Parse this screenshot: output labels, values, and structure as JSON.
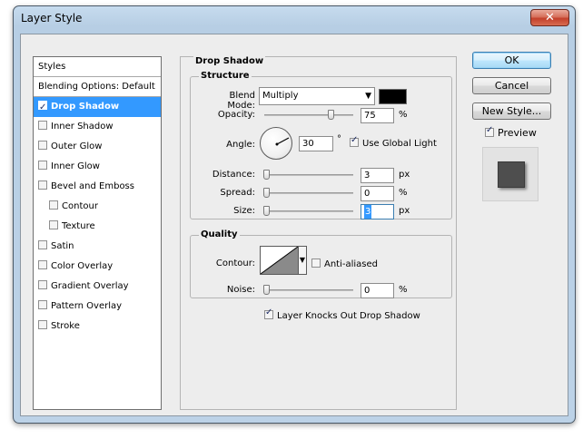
{
  "window": {
    "title": "Layer Style",
    "close_glyph": "✕"
  },
  "styles": {
    "header": "Styles",
    "blending": "Blending Options: Default",
    "items": [
      {
        "label": "Drop Shadow",
        "checked": true,
        "selected": true
      },
      {
        "label": "Inner Shadow",
        "checked": false
      },
      {
        "label": "Outer Glow",
        "checked": false
      },
      {
        "label": "Inner Glow",
        "checked": false
      },
      {
        "label": "Bevel and Emboss",
        "checked": false
      },
      {
        "label": "Contour",
        "checked": false,
        "indent": true
      },
      {
        "label": "Texture",
        "checked": false,
        "indent": true
      },
      {
        "label": "Satin",
        "checked": false
      },
      {
        "label": "Color Overlay",
        "checked": false
      },
      {
        "label": "Gradient Overlay",
        "checked": false
      },
      {
        "label": "Pattern Overlay",
        "checked": false
      },
      {
        "label": "Stroke",
        "checked": false
      }
    ]
  },
  "drop_shadow": {
    "title": "Drop Shadow",
    "structure_title": "Structure",
    "blend_mode_label": "Blend Mode:",
    "blend_mode_value": "Multiply",
    "blend_color": "#000000",
    "opacity_label": "Opacity:",
    "opacity_value": "75",
    "opacity_unit": "%",
    "opacity_level": 0.75,
    "angle_label": "Angle:",
    "angle_value": "30",
    "angle_unit": "°",
    "use_global_light": "Use Global Light",
    "use_global_light_checked": true,
    "distance_label": "Distance:",
    "distance_value": "3",
    "distance_unit": "px",
    "spread_label": "Spread:",
    "spread_value": "0",
    "spread_unit": "%",
    "size_label": "Size:",
    "size_value": "3",
    "size_unit": "px",
    "quality_title": "Quality",
    "contour_label": "Contour:",
    "anti_aliased": "Anti-aliased",
    "anti_aliased_checked": false,
    "noise_label": "Noise:",
    "noise_value": "0",
    "noise_unit": "%",
    "knocks_out": "Layer Knocks Out Drop Shadow",
    "knocks_out_checked": true
  },
  "buttons": {
    "ok": "OK",
    "cancel": "Cancel",
    "new_style": "New Style...",
    "preview": "Preview",
    "preview_checked": true
  },
  "icons": {
    "close": "close-icon",
    "dropdown": "chevron-down-icon",
    "angle": "angle-dial-icon",
    "contour": "contour-curve-icon"
  },
  "colors": {
    "selection": "#3399ff",
    "preview_swatch": "#4e4e4e"
  }
}
